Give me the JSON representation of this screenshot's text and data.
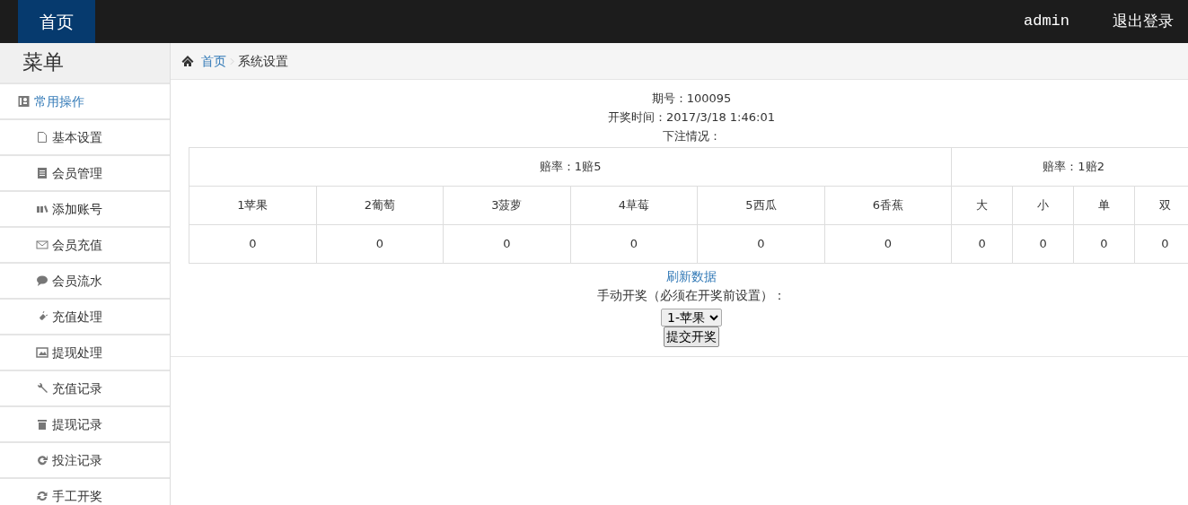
{
  "navbar": {
    "brand": "首页",
    "user": "admin",
    "logout": "退出登录"
  },
  "sidebar": {
    "title": "菜单",
    "group": {
      "label": "常用操作",
      "items": [
        {
          "label": "基本设置"
        },
        {
          "label": "会员管理"
        },
        {
          "label": "添加账号"
        },
        {
          "label": "会员充值"
        },
        {
          "label": "会员流水"
        },
        {
          "label": "充值处理"
        },
        {
          "label": "提现处理"
        },
        {
          "label": "充值记录"
        },
        {
          "label": "提现记录"
        },
        {
          "label": "投注记录"
        },
        {
          "label": "手工开奖"
        }
      ]
    }
  },
  "breadcrumb": [
    {
      "label": "首页",
      "kind": "link"
    },
    {
      "label": "系统设置",
      "kind": "current"
    }
  ],
  "info_lines": [
    "期号：100095",
    "开奖时间：2017/3/18 1:46:01",
    "下注情况："
  ],
  "table": {
    "groups": [
      {
        "label": "赔率：1赔5",
        "columns": [
          "1苹果",
          "2葡萄",
          "3菠萝",
          "4草莓",
          "5西瓜",
          "6香蕉"
        ]
      },
      {
        "label": "赔率：1赔2",
        "columns": [
          "大",
          "小",
          "单",
          "双"
        ]
      }
    ],
    "rows": [
      [
        "0",
        "0",
        "0",
        "0",
        "0",
        "0",
        "0",
        "0",
        "0",
        "0"
      ]
    ]
  },
  "refresh_link": "刷新数据",
  "manual_label": "手动开奖（必须在开奖前设置）：",
  "select": {
    "value": "1-苹果"
  },
  "submit_button": "提交开奖"
}
